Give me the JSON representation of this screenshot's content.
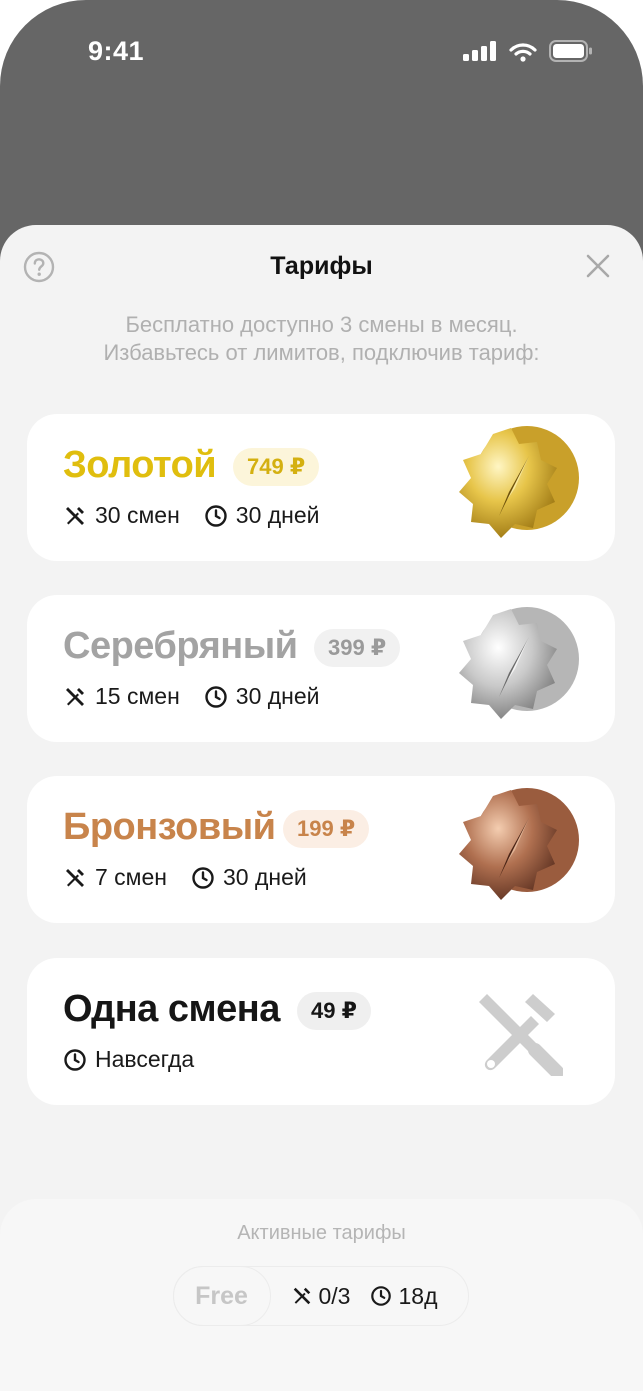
{
  "status_bar": {
    "time": "9:41"
  },
  "sheet": {
    "title": "Тарифы",
    "subtitle_line1": "Бесплатно доступно 3 смены в месяц.",
    "subtitle_line2": "Избавьтесь от лимитов, подключив тариф:"
  },
  "plans": [
    {
      "name": "Золотой",
      "price": "749 ₽",
      "shifts": "30 смен",
      "duration": "30 дней",
      "color": "#E0BE0E",
      "badge_bg": "#FCF5DA",
      "badge_color": "#D4B010",
      "medal": "gold-medal-icon"
    },
    {
      "name": "Серебряный",
      "price": "399 ₽",
      "shifts": "15 смен",
      "duration": "30 дней",
      "color": "#A3A3A3",
      "badge_bg": "#F1F1F1",
      "badge_color": "#9A9A9A",
      "medal": "silver-medal-icon"
    },
    {
      "name": "Бронзовый",
      "price": "199 ₽",
      "shifts": "7 смен",
      "duration": "30 дней",
      "color": "#C8844B",
      "badge_bg": "#FBEEE4",
      "badge_color": "#C8844B",
      "medal": "bronze-medal-icon"
    },
    {
      "name": "Одна смена",
      "price": "49 ₽",
      "duration": "Навсегда",
      "color": "#161616",
      "badge_bg": "#EFEFEF",
      "badge_color": "#161616",
      "medal": "tools-icon"
    }
  ],
  "active": {
    "label": "Активные тарифы",
    "plan": "Free",
    "shifts": "0/3",
    "days": "18д"
  }
}
